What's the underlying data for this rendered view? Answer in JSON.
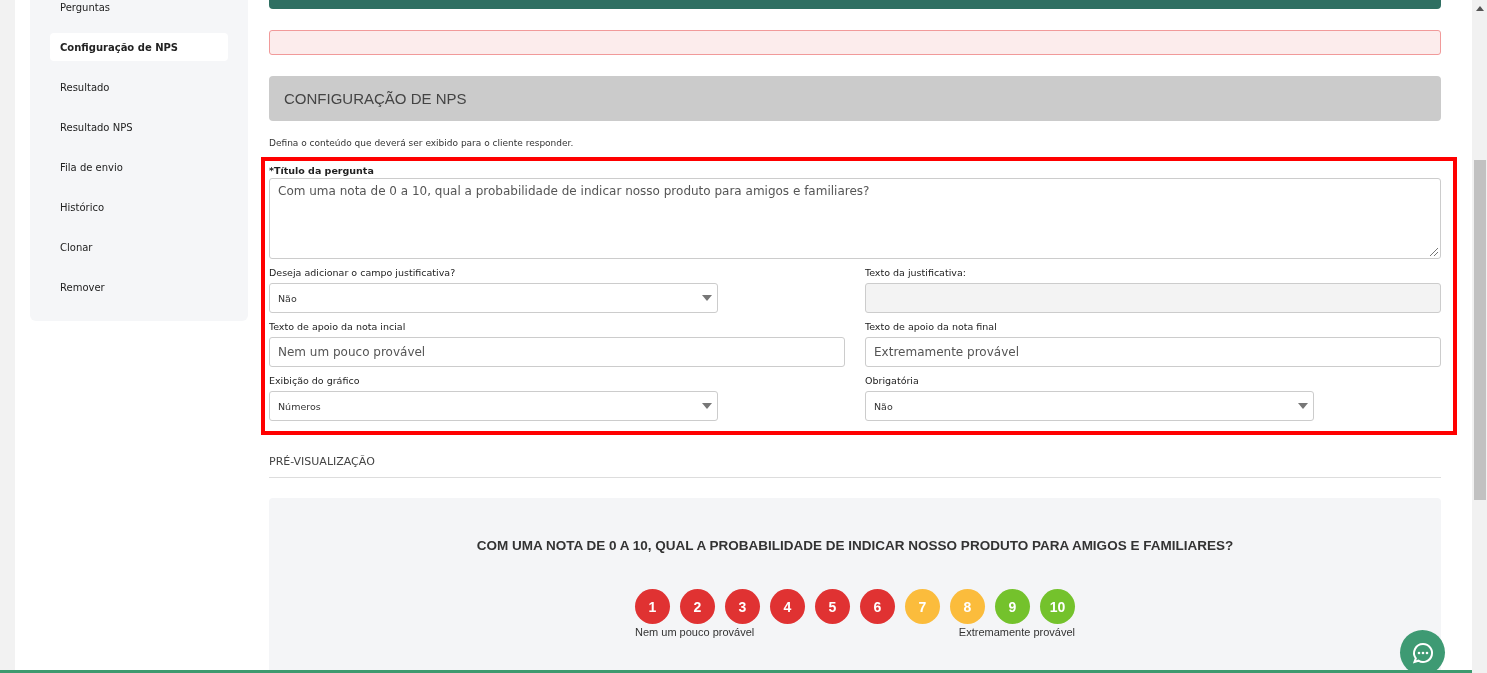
{
  "sidebar": {
    "items": [
      {
        "label": "Perguntas",
        "selected": false
      },
      {
        "label": "Configuração de NPS",
        "selected": true
      },
      {
        "label": "Resultado",
        "selected": false
      },
      {
        "label": "Resultado NPS",
        "selected": false
      },
      {
        "label": "Fila de envio",
        "selected": false
      },
      {
        "label": "Histórico",
        "selected": false
      },
      {
        "label": "Clonar",
        "selected": false
      },
      {
        "label": "Remover",
        "selected": false
      }
    ]
  },
  "section_header": "CONFIGURAÇÃO DE NPS",
  "description": "Defina o conteúdo que deverá ser exibido para o cliente responder.",
  "form": {
    "fields": [
      {
        "kind": "textarea",
        "label": "*Título da pergunta",
        "value": "Com uma nota de 0 a 10, qual a probabilidade de indicar nosso produto para amigos e familiares?",
        "disabled": false
      },
      {
        "kind": "select",
        "label": "Deseja adicionar o campo justificativa?",
        "value": "Não",
        "disabled": false
      },
      {
        "kind": "input",
        "label": "Texto da justificativa:",
        "disabled": true
      },
      {
        "kind": "input",
        "label": "Texto de apoio da nota incial",
        "value": "Nem um pouco provável",
        "disabled": false
      },
      {
        "kind": "input",
        "label": "Texto de apoio da nota final",
        "value": "Extremamente provável",
        "disabled": false
      },
      {
        "kind": "select",
        "label": "Exibição do gráfico",
        "value": "Números",
        "disabled": false
      },
      {
        "kind": "select",
        "label": "Obrigatória",
        "value": "Não",
        "disabled": false
      }
    ]
  },
  "preview": {
    "heading": "PRÉ-VISUALIZAÇÃO",
    "question": "COM UMA NOTA DE 0 A 10, QUAL A PROBABILIDADE DE INDICAR NOSSO PRODUTO PARA AMIGOS E FAMILIARES?",
    "scale": [
      {
        "label": "1",
        "color": "#e03232"
      },
      {
        "label": "2",
        "color": "#e03232"
      },
      {
        "label": "3",
        "color": "#e03232"
      },
      {
        "label": "4",
        "color": "#e03232"
      },
      {
        "label": "5",
        "color": "#e03232"
      },
      {
        "label": "6",
        "color": "#e03232"
      },
      {
        "label": "7",
        "color": "#fbbc3c"
      },
      {
        "label": "8",
        "color": "#fbbc3c"
      },
      {
        "label": "9",
        "color": "#74c22c"
      },
      {
        "label": "10",
        "color": "#74c22c"
      }
    ],
    "low_label": "Nem um pouco provável",
    "high_label": "Extremamente provável"
  }
}
